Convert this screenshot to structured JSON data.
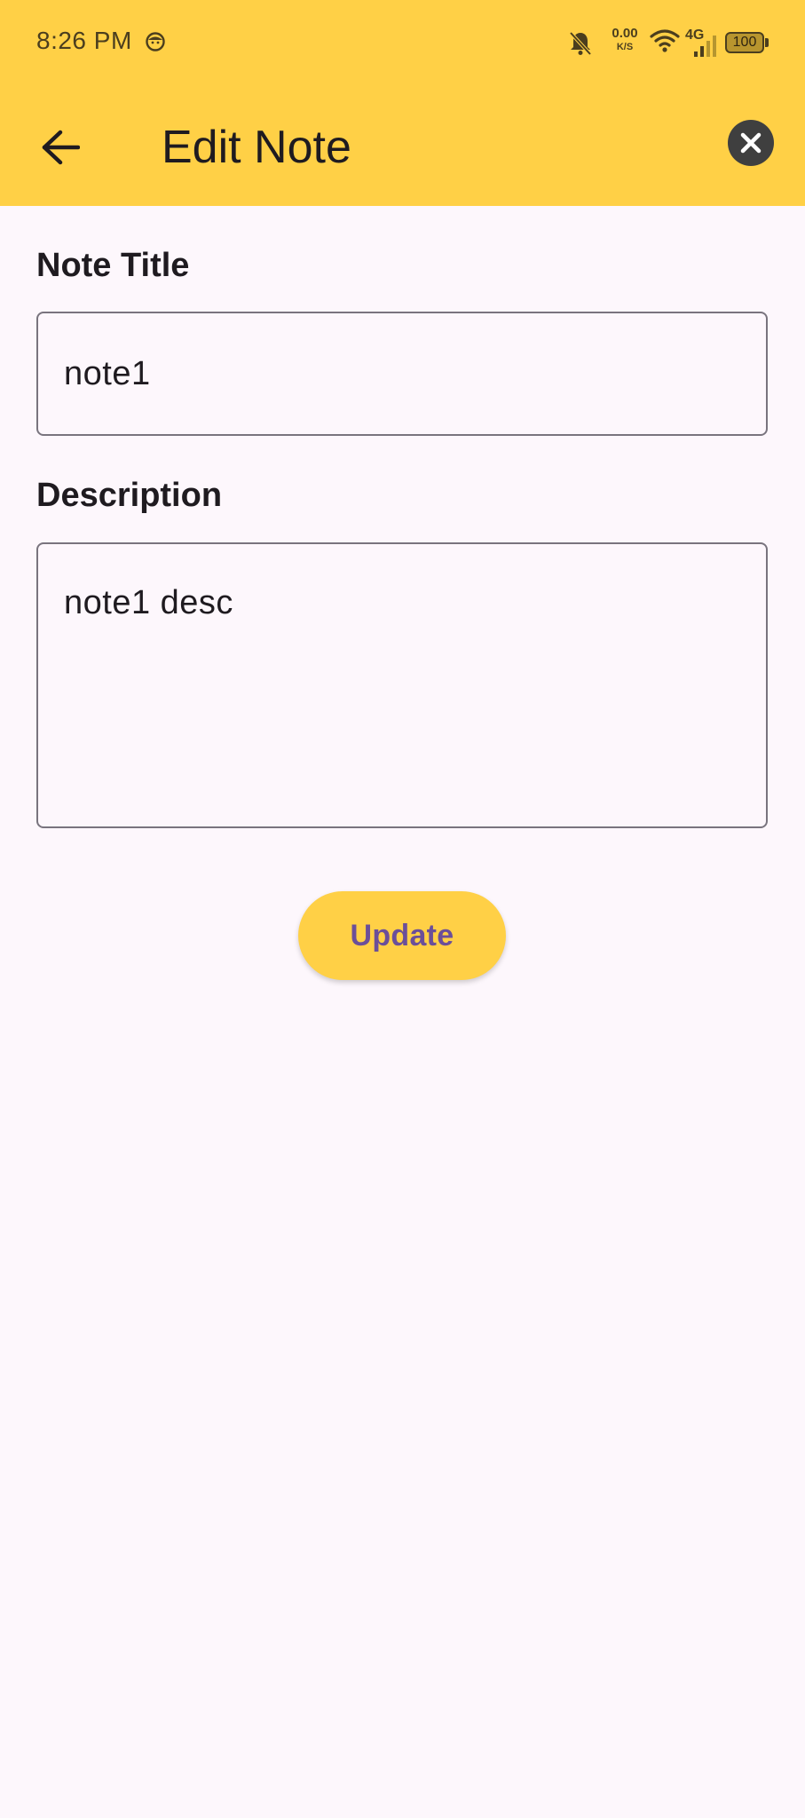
{
  "status_bar": {
    "time": "8:26 PM",
    "network_speed_value": "0.00",
    "network_speed_unit": "K/S",
    "network_type": "4G",
    "battery": "100"
  },
  "app_bar": {
    "title": "Edit Note",
    "back_icon": "arrow-left-icon",
    "close_icon": "close-circle-icon"
  },
  "form": {
    "title_label": "Note Title",
    "title_value": "note1",
    "description_label": "Description",
    "description_value": "note1 desc",
    "update_label": "Update"
  },
  "colors": {
    "accent": "#FFD046",
    "background": "#FDF7FC",
    "button_text": "#6B4F99",
    "input_border": "#79747E"
  }
}
